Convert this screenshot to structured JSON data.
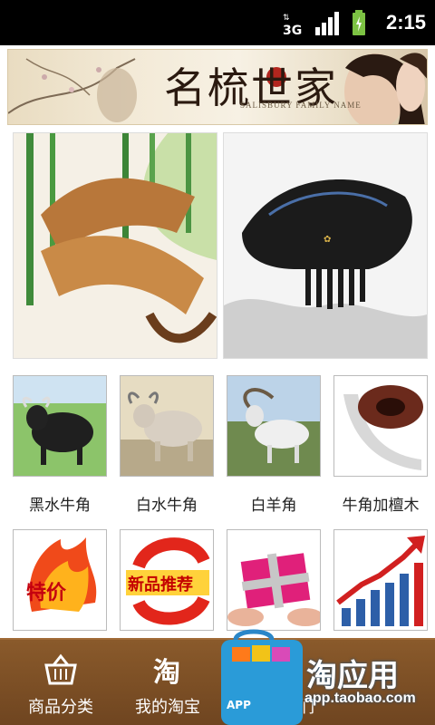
{
  "status": {
    "time": "2:15",
    "network": "3G"
  },
  "banner": {
    "title": "名梳世家",
    "subtitle": "SALISBURY FAMILY NAME"
  },
  "hero": [
    {
      "label": "horn-comb-bamboo-image"
    },
    {
      "label": "black-comb-image"
    }
  ],
  "categories": [
    {
      "label": "黑水牛角"
    },
    {
      "label": "白水牛角"
    },
    {
      "label": "白羊角"
    },
    {
      "label": "牛角加檀木"
    }
  ],
  "promos": [
    {
      "text": "特价"
    },
    {
      "text": "新品推荐"
    },
    {
      "text": ""
    },
    {
      "text": ""
    }
  ],
  "nav": [
    {
      "label": "商品分类",
      "icon": "basket-icon"
    },
    {
      "label": "我的淘宝",
      "icon": "tao-icon"
    },
    {
      "label": "关注我们",
      "icon": "follow-icon"
    }
  ],
  "taobao": {
    "title": "淘应用",
    "url": "app.taobao.com",
    "bag_text": "APP"
  }
}
